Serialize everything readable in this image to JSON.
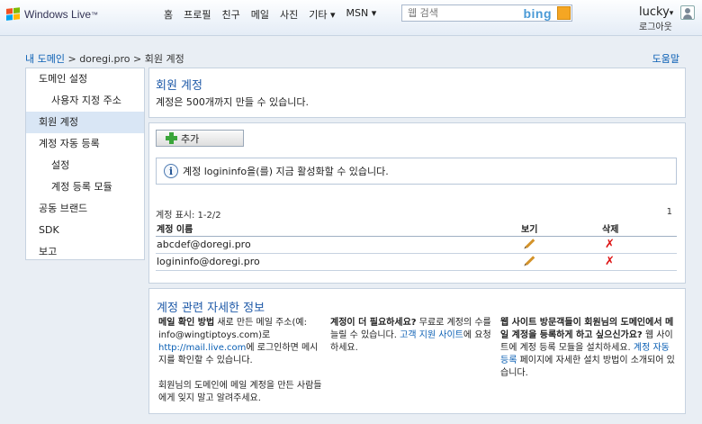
{
  "header": {
    "brand": "Windows Live",
    "brand_tm": "™",
    "nav": [
      "홈",
      "프로필",
      "친구",
      "메일",
      "사진",
      "기타 ▾",
      "MSN ▾"
    ],
    "search_placeholder": "웹 검색",
    "search_engine": "bing",
    "username": "lucky",
    "username_arrow": "▾",
    "logout": "로그아웃"
  },
  "breadcrumb": {
    "root": "내 도메인",
    "domain": "doregi.pro",
    "current": "회원 계정",
    "separator": ">"
  },
  "help": "도움말",
  "sidebar": {
    "items": [
      {
        "label": "도메인 설정",
        "level": 0,
        "active": false
      },
      {
        "label": "사용자 지정 주소",
        "level": 1,
        "active": false
      },
      {
        "label": "회원 계정",
        "level": 0,
        "active": true
      },
      {
        "label": "계정 자동 등록",
        "level": 0,
        "active": false
      },
      {
        "label": "설정",
        "level": 1,
        "active": false
      },
      {
        "label": "계정 등록 모듈",
        "level": 1,
        "active": false
      },
      {
        "label": "공동 브랜드",
        "level": 0,
        "active": false
      },
      {
        "label": "SDK",
        "level": 0,
        "active": false
      },
      {
        "label": "보고",
        "level": 0,
        "active": false
      }
    ]
  },
  "page": {
    "title": "회원 계정",
    "description": "계정은 500개까지 만들 수 있습니다."
  },
  "accounts": {
    "add_button": "추가",
    "info_message": "계정 logininfo을(를) 지금 활성화할 수 있습니다.",
    "count_label": "계정 표시: 1-2/2",
    "page_number": "1",
    "columns": {
      "name": "계정 이름",
      "view": "보기",
      "delete": "삭제"
    },
    "rows": [
      {
        "name": "abcdef@doregi.pro"
      },
      {
        "name": "logininfo@doregi.pro"
      }
    ]
  },
  "details": {
    "title": "계정 관련 자세한 정보",
    "col1": {
      "p1_bold": "메일 확인 방법",
      "p1_text": " 새로 만든 메일 주소(예: info@wingtiptoys.com)로 ",
      "p1_link": "http://mail.live.com",
      "p1_text2": "에 로그인하면 메시지를 확인할 수 있습니다.",
      "p2_text": "회원님의 도메인에 메일 계정을 만든 사람들에게 잊지 말고 알려주세요."
    },
    "col2": {
      "bold": "계정이 더 필요하세요?",
      "text": " 무료로 계정의 수를 늘릴 수 있습니다. ",
      "link": "고객 지원 사이트",
      "text2": "에 요청하세요."
    },
    "col3": {
      "bold": "웹 사이트 방문객들이 회원님의 도메인에서 메일 계정을 등록하게 하고 싶으신가요?",
      "text": " 웹 사이트에 계정 등록 모듈을 설치하세요. ",
      "link": "계정 자동 등록",
      "text2": " 페이지에 자세한 설치 방법이 소개되어 있습니다."
    }
  }
}
